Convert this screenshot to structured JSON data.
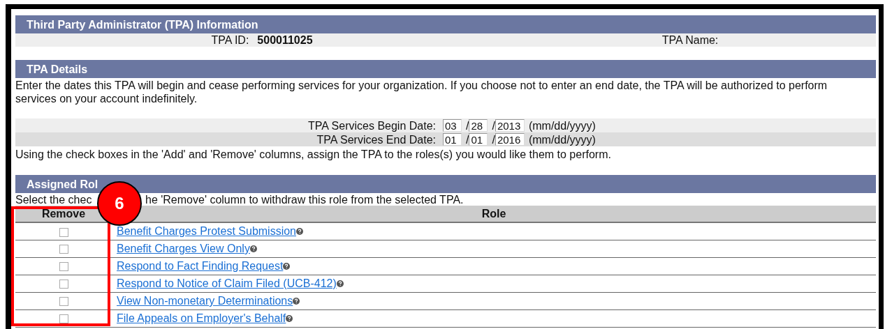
{
  "tpa_information": {
    "title": "Third Party Administrator (TPA) Information",
    "id_label": "TPA ID:",
    "id_value": "500011025",
    "name_label": "TPA Name:"
  },
  "tpa_details": {
    "title": "TPA Details",
    "description": "Enter the dates this TPA will begin and cease performing services for your organization. If you choose not to enter an end date, the TPA will be authorized to perform services on your account indefinitely.",
    "dates": [
      {
        "label": "TPA Services Begin Date:",
        "month": "03",
        "day": "28",
        "year": "2013",
        "separator_1": "/",
        "separator_2": "/",
        "format": "(mm/dd/yyyy)"
      },
      {
        "label": "TPA Services End Date:",
        "month": "01",
        "day": "01",
        "year": "2016",
        "separator_1": "/",
        "separator_2": "/",
        "format": "(mm/dd/yyyy)"
      }
    ],
    "instruction": "Using the check boxes in the 'Add' and 'Remove' columns, assign the TPA to the roles(s) you would like them to perform."
  },
  "assigned_roles": {
    "title": "Assigned Rol",
    "instruction_start": "Select the chec",
    "instruction_end": "he 'Remove' column to withdraw this role from the selected TPA.",
    "columns": [
      "Remove",
      "Role"
    ],
    "rows": [
      {
        "checked": false,
        "role": "Benefit Charges Protest Submission"
      },
      {
        "checked": false,
        "role": "Benefit Charges View Only"
      },
      {
        "checked": false,
        "role": "Respond to Fact Finding Request"
      },
      {
        "checked": false,
        "role": "Respond to Notice of Claim Filed (UCB-412)"
      },
      {
        "checked": false,
        "role": "View Non-monetary Determinations"
      },
      {
        "checked": false,
        "role": "File Appeals on Employer's Behalf"
      }
    ]
  },
  "annotation": {
    "label": "6"
  }
}
